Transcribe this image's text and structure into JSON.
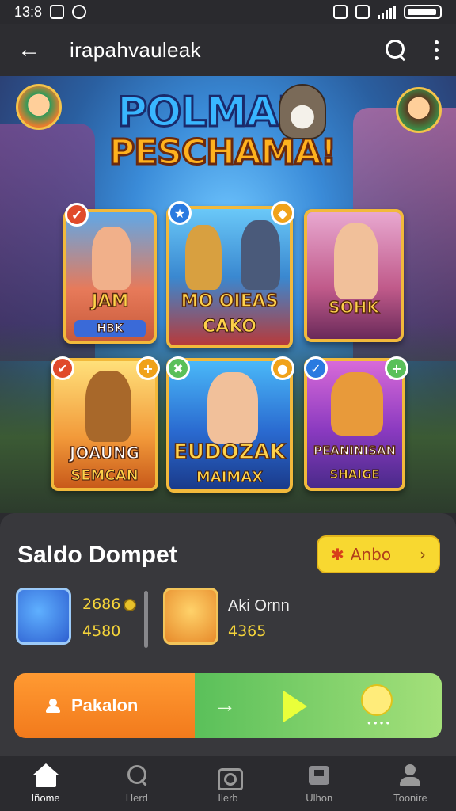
{
  "status": {
    "time": "13:8"
  },
  "app_bar": {
    "title": "irapahvauleak"
  },
  "banner": {
    "logo_line1": "POLMAD",
    "logo_line2": "PESCHAMA!",
    "cards": [
      {
        "title": "JAM",
        "sub": "HBK"
      },
      {
        "title": "MO OIEAS",
        "sub": "CAKO"
      },
      {
        "title": "SOHK",
        "sub": ""
      },
      {
        "title": "JOAUNG",
        "sub": "SEMCAN"
      },
      {
        "title": "EUDOZAK",
        "sub": "MAIMAX"
      },
      {
        "title": "PEANINISAN",
        "sub": "SHAIGE"
      }
    ]
  },
  "wallet": {
    "title": "Saldo Dompet",
    "action_label": "Anbo",
    "item1": {
      "value_top": "2686",
      "value_bottom": "4580"
    },
    "item2": {
      "label": "Aki Ornn",
      "value": "4365"
    }
  },
  "cta": {
    "label": "Pakalon"
  },
  "nav": [
    {
      "label": "Iñome",
      "icon": "home-icon"
    },
    {
      "label": "Herd",
      "icon": "search-icon"
    },
    {
      "label": "Ilerb",
      "icon": "camera-icon"
    },
    {
      "label": "Ulhon",
      "icon": "box-icon"
    },
    {
      "label": "Toonire",
      "icon": "user-icon"
    }
  ],
  "colors": {
    "accent_yellow": "#f8d830",
    "cta_orange": "#f27a1c",
    "cta_green": "#5ac05a",
    "panel": "#38383c"
  }
}
